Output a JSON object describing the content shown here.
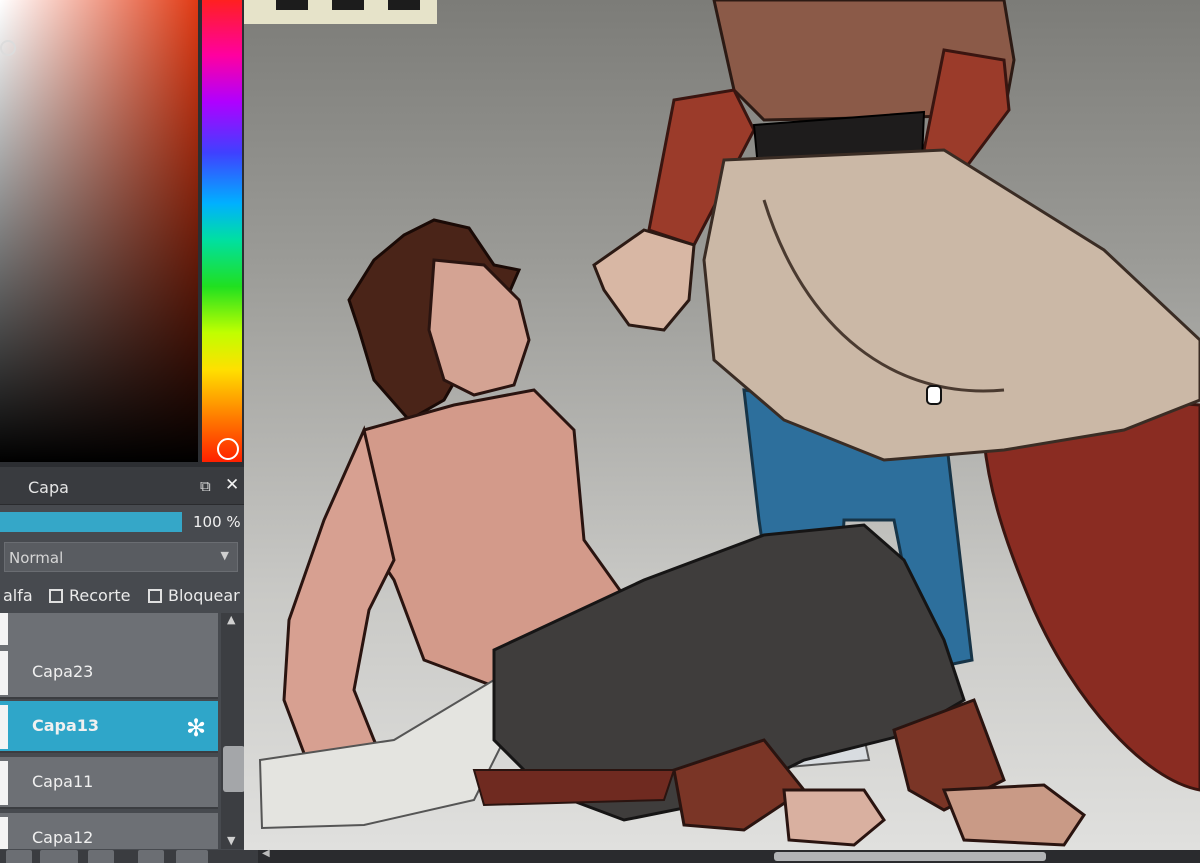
{
  "colors": {
    "accent": "#2fa6c9",
    "selected_hue": "#e03a14",
    "panel_bg": "#474a4f",
    "row_bg": "#6d7075"
  },
  "layer_panel": {
    "title": "Capa",
    "opacity": {
      "label": "100 %",
      "value": 1.0
    },
    "blend_mode": "Normal",
    "options": {
      "alpha_label": "alfa",
      "clipping_label": "Recorte",
      "lock_label": "Bloquear"
    },
    "layers": [
      {
        "name": "Capa23",
        "selected": false
      },
      {
        "name": "Capa13",
        "selected": true
      },
      {
        "name": "Capa11",
        "selected": false
      },
      {
        "name": "Capa12",
        "selected": false
      }
    ]
  },
  "icons": {
    "popout": "external-window",
    "close": "close-x",
    "layer_settings": "gear"
  }
}
